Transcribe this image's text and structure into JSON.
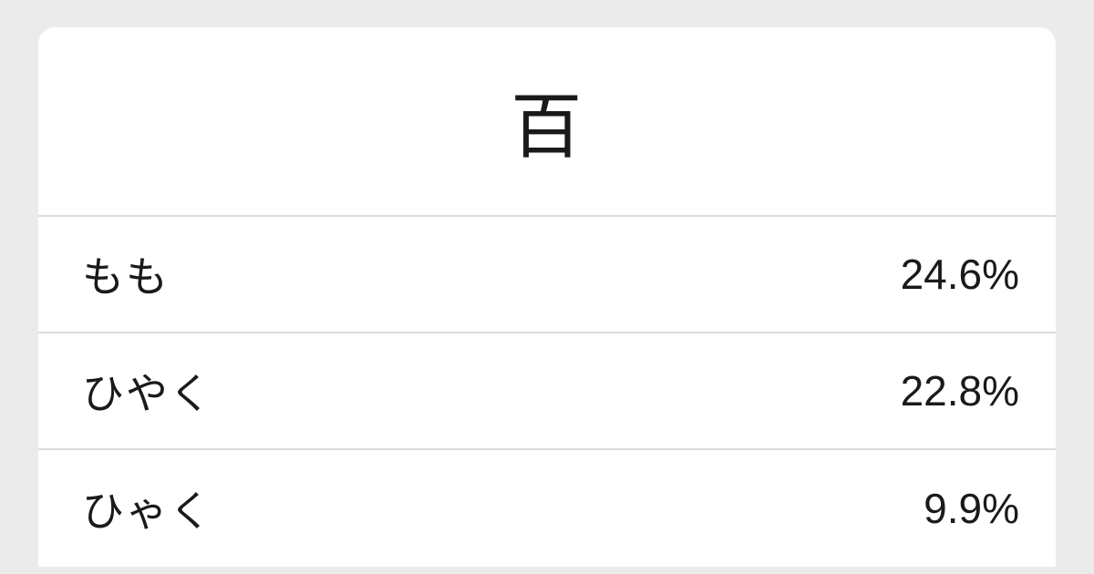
{
  "header": {
    "kanji": "百"
  },
  "readings": [
    {
      "text": "もも",
      "percent": "24.6%"
    },
    {
      "text": "ひやく",
      "percent": "22.8%"
    },
    {
      "text": "ひゃく",
      "percent": "9.9%"
    }
  ]
}
